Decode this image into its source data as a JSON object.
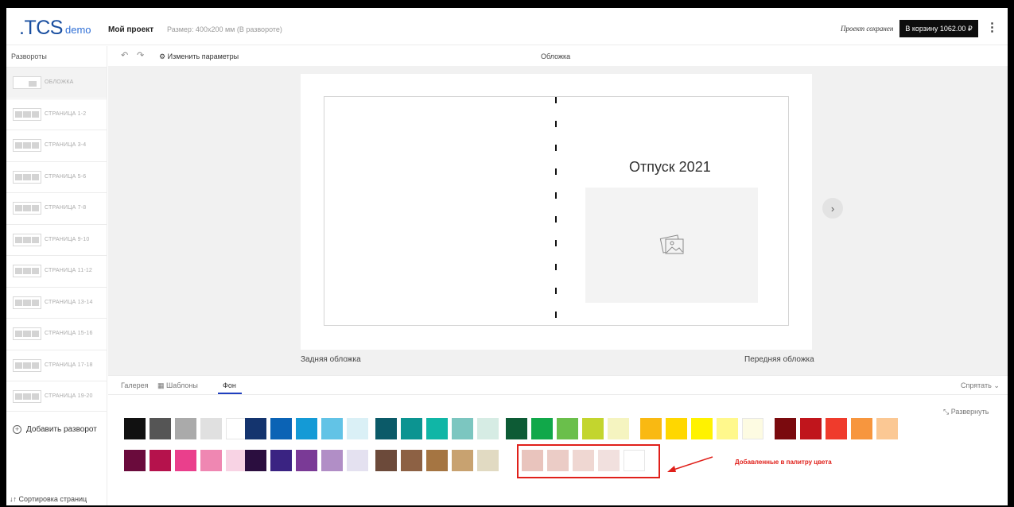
{
  "header": {
    "logo": ".TCS",
    "logo_suffix": "demo",
    "project_name": "Мой проект",
    "project_size": "Размер: 400x200 мм (В развороте)",
    "saved_status": "Проект сохранен",
    "cart_button": "В корзину 1062.00 ₽",
    "menu_icon": "kebab-icon"
  },
  "sidebar": {
    "title": "Развороты",
    "items": [
      {
        "label": "ОБЛОЖКА"
      },
      {
        "label": "СТРАНИЦА 1-2"
      },
      {
        "label": "СТРАНИЦА 3-4"
      },
      {
        "label": "СТРАНИЦА 5-6"
      },
      {
        "label": "СТРАНИЦА 7-8"
      },
      {
        "label": "СТРАНИЦА 9-10"
      },
      {
        "label": "СТРАНИЦА 11-12"
      },
      {
        "label": "СТРАНИЦА 13-14"
      },
      {
        "label": "СТРАНИЦА 15-16"
      },
      {
        "label": "СТРАНИЦА 17-18"
      },
      {
        "label": "СТРАНИЦА 19-20"
      }
    ],
    "add_spread": "Добавить разворот",
    "sort_pages": "↓↑ Сортировка страниц"
  },
  "toolbar": {
    "change_params": "Изменить параметры",
    "current_spread": "Обложка"
  },
  "canvas": {
    "book_title": "Отпуск 2021",
    "back_cover_label": "Задняя обложка",
    "front_cover_label": "Передняя обложка"
  },
  "panel": {
    "tabs": [
      {
        "label": "Галерея",
        "active": false
      },
      {
        "label": "Шаблоны",
        "active": false
      },
      {
        "label": "Фон",
        "active": true
      }
    ],
    "hide_label": "Спрятать",
    "expand_label": "Развернуть",
    "annotation": "Добавленные в палитру цвета",
    "palette_row1": [
      "#111111",
      "#555555",
      "#aaaaaa",
      "#e0e0e0",
      "#ffffff",
      "#14346e",
      "#0b63b5",
      "#149ad6",
      "#62c3e6",
      "#daf0f6",
      "#0b5a68",
      "#0c9491",
      "#10b6a6",
      "#7cc6c0",
      "#d6ece4",
      "#0d5b35",
      "#11a84a",
      "#6abf4b",
      "#c3d52e",
      "#f5f4c0",
      "#f9b912",
      "#ffd700",
      "#fff200",
      "#fff88c",
      "#fdfbe2",
      "#7a0a0e",
      "#c0151c",
      "#ef3b2c",
      "#f7963e",
      "#fbc894"
    ],
    "palette_row2": [
      "#6a0b3c",
      "#b5124c",
      "#ea3f8c",
      "#ef87b2",
      "#f8d3e4",
      "#2b0e3f",
      "#3a2382",
      "#7a3a96",
      "#b18ec6",
      "#e4e1f0",
      "#6c4a3a",
      "#8d6144",
      "#a57542",
      "#c8a270",
      "#e1dac2"
    ],
    "palette_added": [
      "#e9c4bd",
      "#ebccc6",
      "#efd7d2",
      "#f1e0de",
      "#ffffff"
    ]
  }
}
